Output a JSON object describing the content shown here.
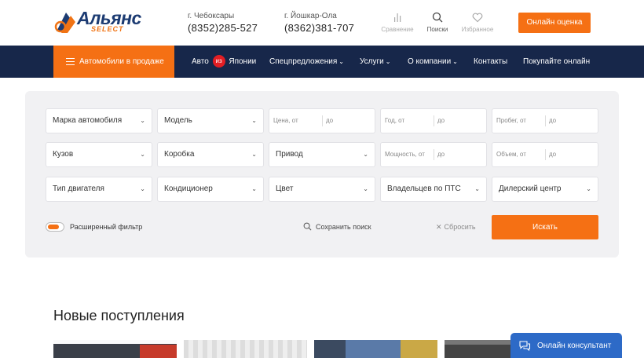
{
  "brand": {
    "name": "Альянс",
    "sub": "SELECT"
  },
  "contacts": [
    {
      "city": "г. Чебоксары",
      "phone": "(8352)285-527"
    },
    {
      "city": "г. Йошкар-Ола",
      "phone": "(8362)381-707"
    }
  ],
  "header_icons": [
    {
      "label": "Сравнение",
      "icon": "bar-chart-icon"
    },
    {
      "label": "Поиски",
      "icon": "search-icon"
    },
    {
      "label": "Избранное",
      "icon": "heart-icon"
    }
  ],
  "cta_label": "Онлайн оценка",
  "nav": {
    "cars_label": "Автомобили в продаже",
    "japan": {
      "pre": "Авто",
      "badge": "из",
      "post": "Японии"
    },
    "items": [
      "Спецпредложения",
      "Услуги",
      "О компании",
      "Контакты",
      "Покупайте онлайн"
    ]
  },
  "filters": {
    "make": "Марка автомобиля",
    "model": "Модель",
    "price": {
      "from": "Цена, от",
      "to": "до"
    },
    "year": {
      "from": "Год, от",
      "to": "до"
    },
    "mileage": {
      "from": "Пробег, от",
      "to": "до"
    },
    "body": "Кузов",
    "gearbox": "Коробка",
    "drive": "Привод",
    "power": {
      "from": "Мощность, от",
      "to": "до"
    },
    "volume": {
      "from": "Объем, от",
      "to": "до"
    },
    "engine": "Тип двигателя",
    "ac": "Кондиционер",
    "color": "Цвет",
    "owners": "Владельцев по ПТС",
    "dealer": "Дилерский центр"
  },
  "advanced_filter_label": "Расширенный фильтр",
  "save_search_label": "Сохранить поиск",
  "reset_label": "Сбросить",
  "search_button_label": "Искать",
  "new_arrivals_title": "Новые поступления",
  "consultant_label": "Онлайн консультант",
  "colors": {
    "accent": "#f57014",
    "navy": "#17274a",
    "consultant": "#2d6ac7"
  }
}
